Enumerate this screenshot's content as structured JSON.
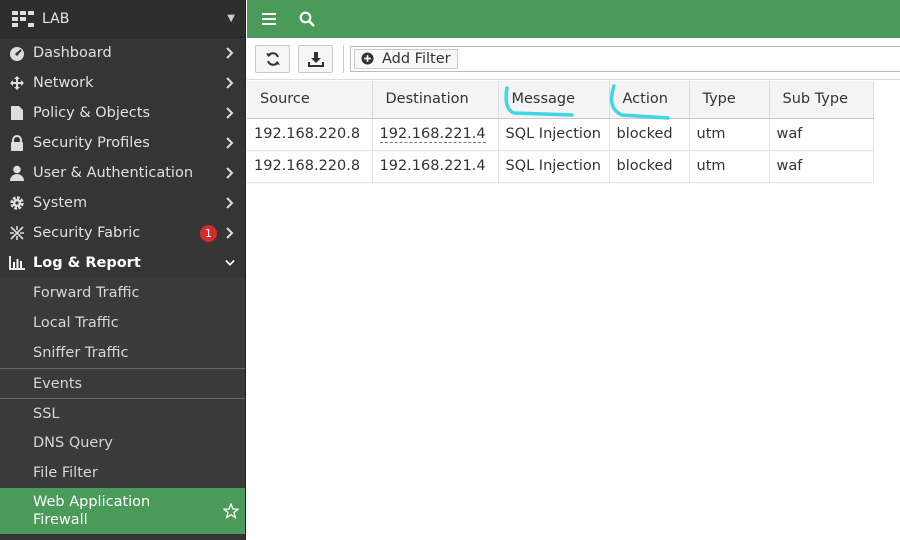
{
  "sidebar": {
    "brand": "LAB",
    "items": [
      {
        "label": "Dashboard",
        "icon": "dashboard-icon"
      },
      {
        "label": "Network",
        "icon": "network-icon"
      },
      {
        "label": "Policy & Objects",
        "icon": "policy-icon"
      },
      {
        "label": "Security Profiles",
        "icon": "lock-icon"
      },
      {
        "label": "User & Authentication",
        "icon": "user-icon"
      },
      {
        "label": "System",
        "icon": "gear-icon"
      },
      {
        "label": "Security Fabric",
        "icon": "fabric-icon",
        "badge": "1"
      },
      {
        "label": "Log & Report",
        "icon": "chart-icon"
      }
    ],
    "sub_items": [
      {
        "label": "Forward Traffic"
      },
      {
        "label": "Local Traffic"
      },
      {
        "label": "Sniffer Traffic"
      },
      {
        "label": "Events"
      },
      {
        "label": "SSL"
      },
      {
        "label": "DNS Query"
      },
      {
        "label": "File Filter"
      },
      {
        "label": "Web Application Firewall"
      }
    ]
  },
  "toolbar": {
    "add_filter_label": "Add Filter"
  },
  "table": {
    "columns": [
      "Source",
      "Destination",
      "Message",
      "Action",
      "Type",
      "Sub Type"
    ],
    "rows": [
      [
        "192.168.220.8",
        "192.168.221.4",
        "SQL Injection",
        "blocked",
        "utm",
        "waf"
      ],
      [
        "192.168.220.8",
        "192.168.221.4",
        "SQL Injection",
        "blocked",
        "utm",
        "waf"
      ]
    ]
  },
  "colors": {
    "accent": "#4a9a5a",
    "sidebar": "#353535",
    "badge": "#d62b2b",
    "highlight": "#3fd6e6"
  }
}
